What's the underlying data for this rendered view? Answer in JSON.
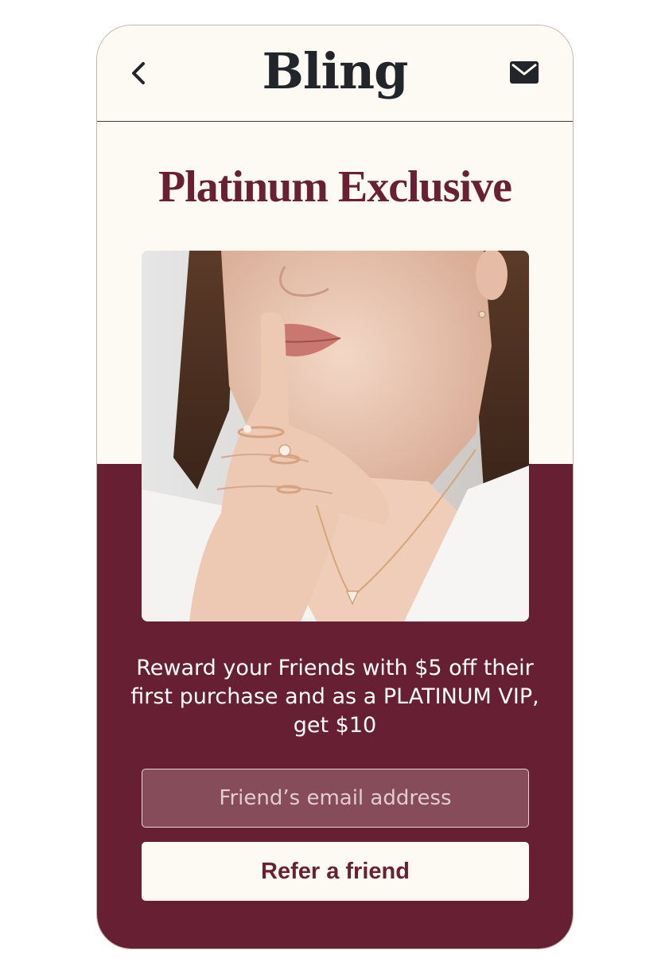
{
  "header": {
    "logo_text": "Bling",
    "back_icon": "chevron-left-icon",
    "mail_icon": "mail-icon"
  },
  "main": {
    "title": "Platinum Exclusive",
    "hero_image": "woman-with-jewelry-finger-on-lips",
    "reward_text": "Reward your Friends with $5 off their first purchase and as a PLATINUM VIP, get $10",
    "email_placeholder": "Friend’s email address",
    "email_value": "",
    "refer_button_label": "Refer a friend"
  },
  "colors": {
    "accent": "#672033",
    "background": "#fcfaf3",
    "text_dark": "#22262b"
  }
}
